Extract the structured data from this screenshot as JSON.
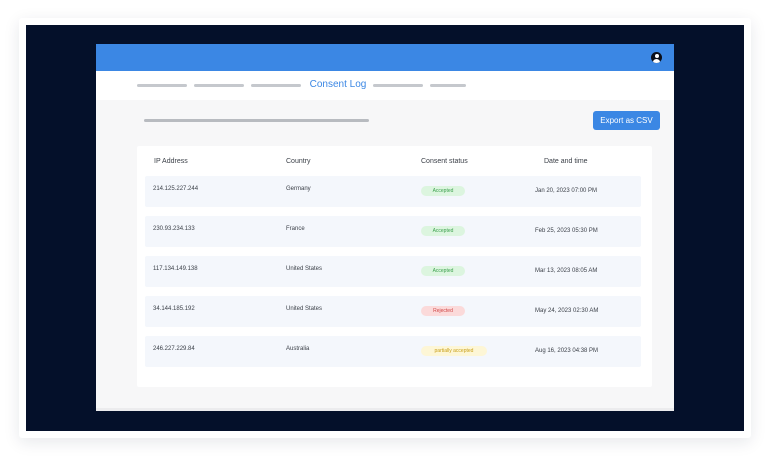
{
  "header": {
    "avatar_icon": "user-circle-icon",
    "brand_color": "#3b87e4"
  },
  "nav": {
    "active_label": "Consent Log"
  },
  "toolbar": {
    "export_label": "Export as CSV"
  },
  "table": {
    "columns": [
      "IP Address",
      "Country",
      "Consent status",
      "Date and time"
    ],
    "rows": [
      {
        "ip": "214.125.227.244",
        "country": "Germany",
        "status": "Accepted",
        "status_type": "accepted",
        "datetime": "Jan 20, 2023 07:00 PM"
      },
      {
        "ip": "230.93.234.133",
        "country": "France",
        "status": "Accepted",
        "status_type": "accepted",
        "datetime": "Feb 25, 2023 05:30 PM"
      },
      {
        "ip": "117.134.149.138",
        "country": "United States",
        "status": "Accepted",
        "status_type": "accepted",
        "datetime": "Mar 13, 2023 08:05 AM"
      },
      {
        "ip": "34.144.185.192",
        "country": "United States",
        "status": "Rejected",
        "status_type": "rejected",
        "datetime": "May 24, 2023 02:30 AM"
      },
      {
        "ip": "246.227.229.84",
        "country": "Australia",
        "status": "partially accepted",
        "status_type": "partial",
        "datetime": "Aug 16, 2023 04:38 PM"
      }
    ]
  },
  "status_colors": {
    "accepted": "#3ca04d",
    "rejected": "#d04545",
    "partial": "#c9a019"
  }
}
